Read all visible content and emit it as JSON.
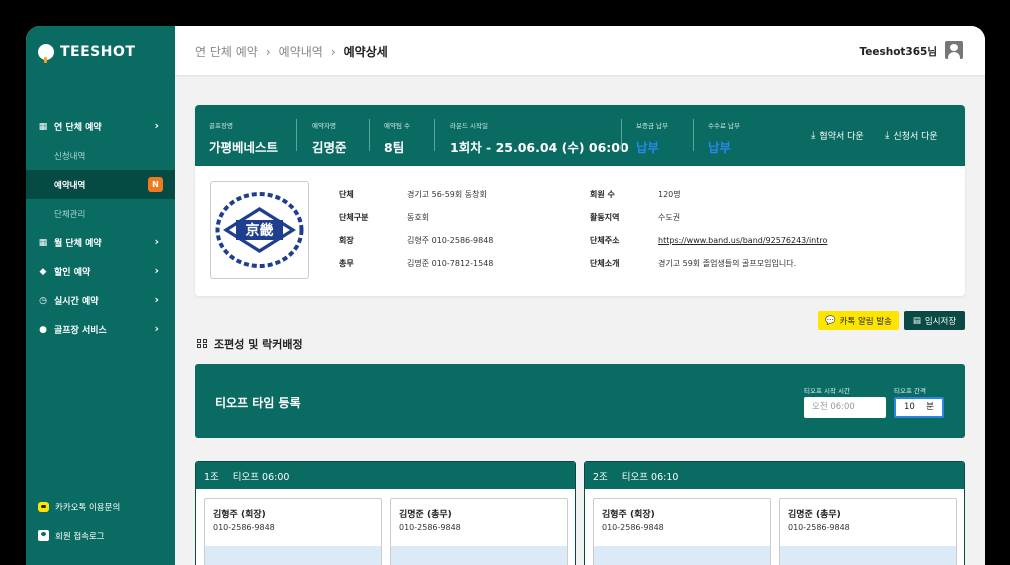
{
  "brand": {
    "name": "TEESHOT"
  },
  "sidebar": {
    "items": [
      {
        "label": "연 단체 예약",
        "icon": "calendar-icon"
      },
      {
        "label": "월 단체 예약",
        "icon": "calendar-icon"
      },
      {
        "label": "할인 예약",
        "icon": "tag-icon"
      },
      {
        "label": "실시간 예약",
        "icon": "alarm-clock-icon"
      },
      {
        "label": "골프장 서비스",
        "icon": "pin-icon"
      }
    ],
    "subitems": [
      {
        "label": "신청내역"
      },
      {
        "label": "예약내역",
        "badge": "N"
      },
      {
        "label": "단체관리"
      }
    ],
    "bottom": [
      {
        "label": "카카오톡 이용문의"
      },
      {
        "label": "회원 접속로그"
      }
    ]
  },
  "header": {
    "breadcrumb": [
      "연 단체 예약",
      "예약내역",
      "예약상세"
    ],
    "user": "Teeshot365님"
  },
  "summary": {
    "course_label": "골프장명",
    "course": "가평베네스트",
    "booker_label": "예약자명",
    "booker": "김명준",
    "teams_label": "예약팀 수",
    "teams": "8팀",
    "round_label": "라운드 시작일",
    "round": "1회차 - 25.06.04 (수) 06:00",
    "deposit_label": "보증금 납부",
    "deposit": "납부",
    "fee_label": "수수료 납부",
    "fee": "납부",
    "btn_agreement": "협약서 다운",
    "btn_application": "신청서 다운"
  },
  "group_info": {
    "logo_text": "京畿",
    "fields": [
      {
        "k": "단체",
        "v": "경기고 56-59회 동창회"
      },
      {
        "k": "단체구분",
        "v": "동호회"
      },
      {
        "k": "회장",
        "v": "김형주  010-2586-9848"
      },
      {
        "k": "총무",
        "v": "김명준  010-7812-1548"
      },
      {
        "k": "회원 수",
        "v": "120명"
      },
      {
        "k": "활동지역",
        "v": "수도권"
      },
      {
        "k": "단체주소",
        "v": "https://www.band.us/band/92576243/intro"
      },
      {
        "k": "단체소개",
        "v": "경기고 59회 졸업생들의 골프모임입니다."
      }
    ]
  },
  "actions": {
    "kakao": "카톡 알림 발송",
    "save": "임시저장"
  },
  "section": {
    "title": "조편성 및 락커배정"
  },
  "teeoff": {
    "title": "티오프 타임 등록",
    "start_label": "티오프 시작 시간",
    "start_placeholder": "오전 06:00",
    "interval_label": "티오프 간격",
    "interval_value": "10",
    "interval_unit": "분"
  },
  "groups": [
    {
      "name": "1조",
      "time": "티오프 06:00",
      "members": [
        {
          "name": "김형주 (회장)",
          "phone": "010-2586-9848"
        },
        {
          "name": "김명준 (총무)",
          "phone": "010-2586-9848"
        }
      ]
    },
    {
      "name": "2조",
      "time": "티오프 06:10",
      "members": [
        {
          "name": "김형주 (회장)",
          "phone": "010-2586-9848"
        },
        {
          "name": "김명준 (총무)",
          "phone": "010-2586-9848"
        }
      ]
    }
  ],
  "colors": {
    "primary": "#0a6b63",
    "dark": "#0a4a44",
    "accent": "#f07a22",
    "kakao": "#fee500",
    "link_blue": "#2b86e6"
  }
}
